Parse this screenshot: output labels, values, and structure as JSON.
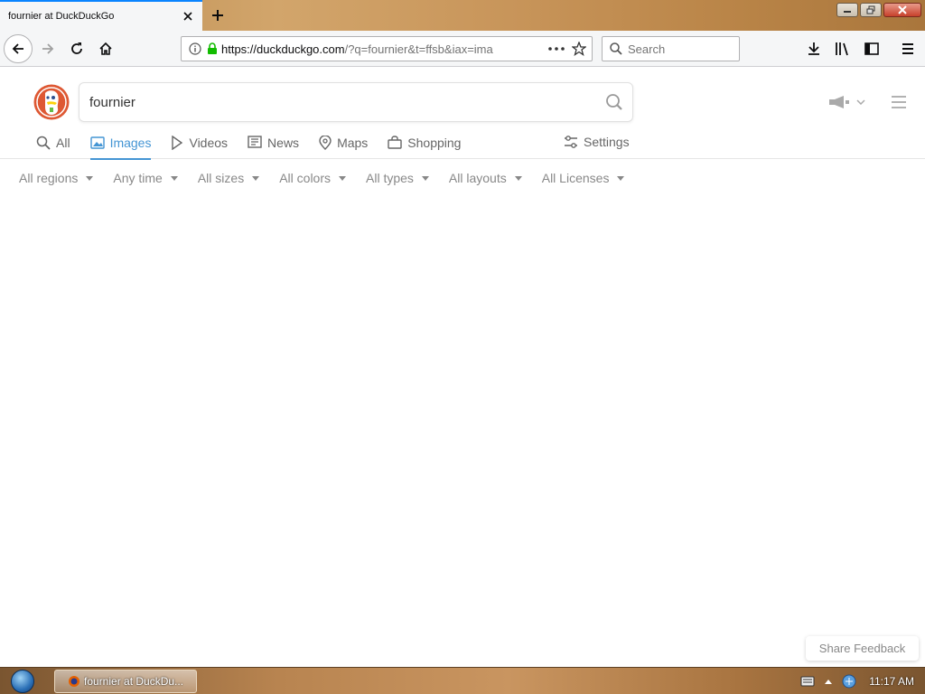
{
  "browser": {
    "tab_title": "fournier at DuckDuckGo",
    "url_host": "https://duckduckgo.com",
    "url_rest": "/?q=fournier&t=ffsb&iax=ima",
    "search_placeholder": "Search"
  },
  "ddg": {
    "query": "fournier",
    "tabs": [
      {
        "label": "All",
        "icon": "search-icon"
      },
      {
        "label": "Images",
        "icon": "image-icon",
        "active": true
      },
      {
        "label": "Videos",
        "icon": "play-icon"
      },
      {
        "label": "News",
        "icon": "newspaper-icon"
      },
      {
        "label": "Maps",
        "icon": "map-pin-icon"
      },
      {
        "label": "Shopping",
        "icon": "shopping-bag-icon"
      }
    ],
    "settings_label": "Settings",
    "filters": [
      "All regions",
      "Any time",
      "All sizes",
      "All colors",
      "All types",
      "All layouts",
      "All Licenses"
    ],
    "feedback_label": "Share Feedback"
  },
  "taskbar": {
    "task_label": "fournier at DuckDu...",
    "clock": "11:17 AM"
  },
  "colors": {
    "accent_blue": "#4495d4",
    "ddg_orange": "#de5833",
    "firefox_blue": "#0a84ff"
  }
}
